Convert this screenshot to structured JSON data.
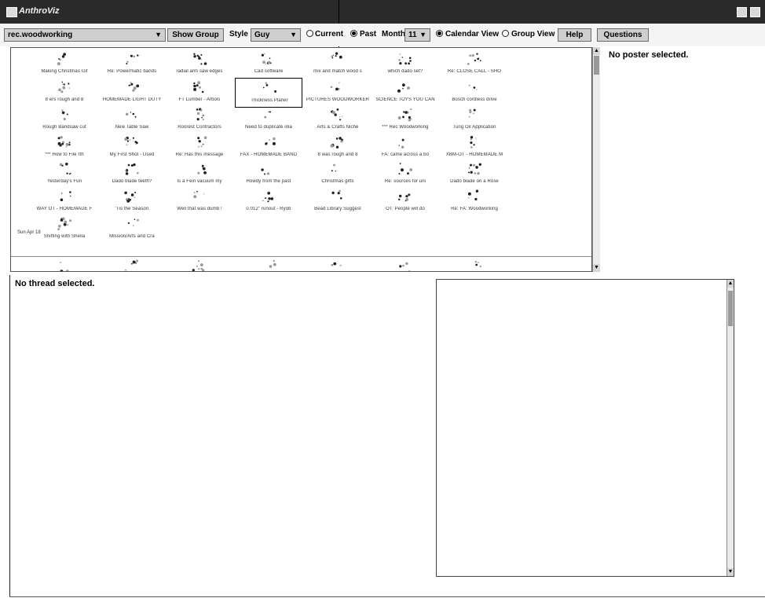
{
  "window": {
    "title": "AnthroViz"
  },
  "toolbar": {
    "newsgroup": "rec.woodworking",
    "show_group": "Show Group",
    "style_label": "Style",
    "style_value": "Guy",
    "radio_current": "Current",
    "radio_past": "Past",
    "month_label": "Month",
    "month_value": "11",
    "radio_calendar": "Calendar View",
    "radio_group": "Group View",
    "help": "Help",
    "questions": "Questions",
    "selected_time": "Past",
    "selected_view": "Calendar View"
  },
  "grid": {
    "date_label": "Sun Apr 18",
    "rows": [
      [
        "Making Christmas Gif",
        "Re: Powermatic bands",
        "radial arm saw edges",
        "Cad software",
        "mix and match wood s",
        "which dado set?",
        "Re: CLOSE CALL - SHO"
      ],
      [
        "8 ers rough and 8",
        "HOMEMADE LIGHT DUTY",
        "FT Lumber - Arbols",
        "Thickness Planer",
        "PICTURES WOODWORKER",
        "SCIENCE TOYS YOU CAN",
        "Bosch cordless drive"
      ],
      [
        "Rough Bandsaw cut",
        "New Table Saw",
        "Roorest Contractors",
        "Need to duplicate inla",
        "Arts & Crafts Niche",
        "*** Rec Woodworking",
        "Tung Oil Application"
      ],
      [
        "*** How to File rth",
        "My First Shot - Used",
        "Re: Has this message",
        "FAX - HOMEMADE BAND",
        "8 was rough and 8",
        "FA: came across a bo",
        "XBM-OT - HOMEMADE M"
      ],
      [
        "Yesterday's Fun",
        "Dado blade teeth?",
        "Is a Fein vacuum my",
        "Howdy from the past",
        "Christmas gifts",
        "Re: sources for uni",
        "Dado blade on a Rose"
      ],
      [
        "WAY OT - HOMEMADE F",
        "'Tis the Season",
        "Well that was dumb !",
        "0.012\" runout - Ryob",
        "Bead Library Suggest",
        "OT: People will do",
        "Re: FA: Woodworking"
      ],
      [
        "Sniffing with Sheila",
        "Mission/Arts and Cra",
        "",
        "",
        "",
        "",
        ""
      ]
    ]
  },
  "panels": {
    "poster_status": "No poster selected.",
    "thread_status": "No thread selected."
  }
}
